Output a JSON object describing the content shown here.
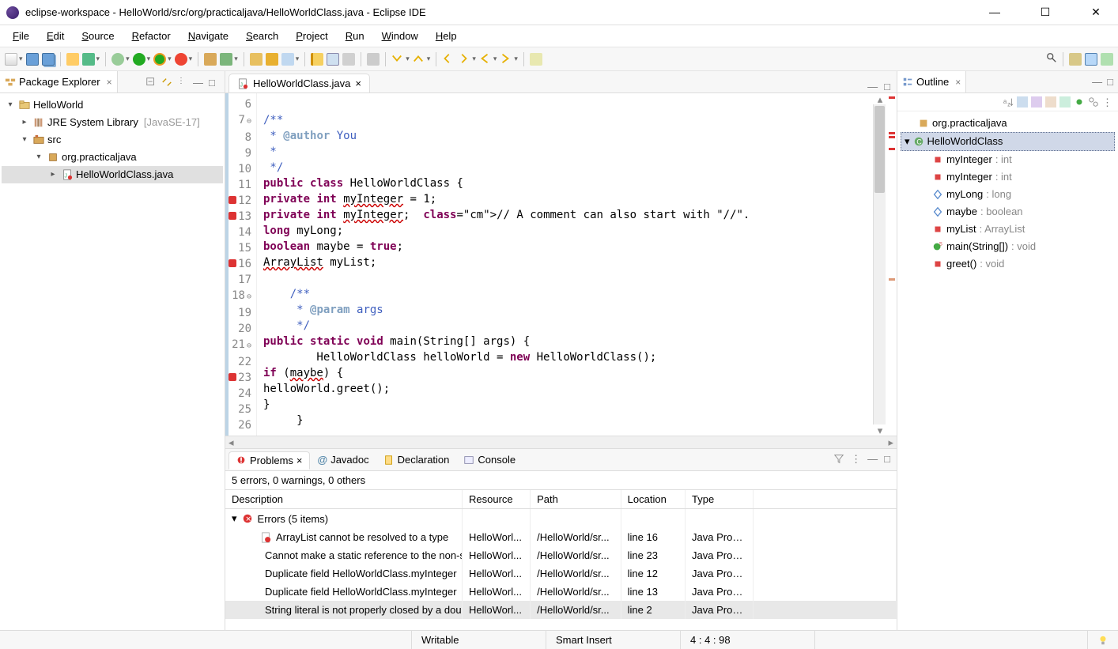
{
  "window": {
    "title": "eclipse-workspace - HelloWorld/src/org/practicaljava/HelloWorldClass.java - Eclipse IDE"
  },
  "menu": [
    "File",
    "Edit",
    "Source",
    "Refactor",
    "Navigate",
    "Search",
    "Project",
    "Run",
    "Window",
    "Help"
  ],
  "package_explorer": {
    "title": "Package Explorer",
    "project": "HelloWorld",
    "jre": "JRE System Library",
    "jre_ver": "[JavaSE-17]",
    "src": "src",
    "pkg": "org.practicaljava",
    "file": "HelloWorldClass.java"
  },
  "editor": {
    "tab": "HelloWorldClass.java",
    "lines": [
      {
        "n": "6",
        "t": ""
      },
      {
        "n": "7",
        "fold": "⊖",
        "t": "/**",
        "cls": "jd"
      },
      {
        "n": "8",
        "t": " * @author You",
        "cls": "jd",
        "tag": true
      },
      {
        "n": "9",
        "t": " *",
        "cls": "jd"
      },
      {
        "n": "10",
        "t": " */",
        "cls": "jd"
      },
      {
        "n": "11",
        "t": "public class HelloWorldClass {"
      },
      {
        "n": "12",
        "err": true,
        "t": "private int myInteger = 1;"
      },
      {
        "n": "13",
        "err": true,
        "t": "private int myInteger;  // A comment can also start with \"//\"."
      },
      {
        "n": "14",
        "t": "long myLong;"
      },
      {
        "n": "15",
        "t": "boolean maybe = true;"
      },
      {
        "n": "16",
        "err": true,
        "t": "ArrayList myList;"
      },
      {
        "n": "17",
        "t": ""
      },
      {
        "n": "18",
        "fold": "⊖",
        "t": "    /**",
        "cls": "jd"
      },
      {
        "n": "19",
        "t": "     * @param args",
        "cls": "jd",
        "tag": true
      },
      {
        "n": "20",
        "t": "     */",
        "cls": "jd"
      },
      {
        "n": "21",
        "fold": "⊖",
        "t": "public static void main(String[] args) {"
      },
      {
        "n": "22",
        "t": "        HelloWorldClass helloWorld = new HelloWorldClass();"
      },
      {
        "n": "23",
        "err": true,
        "t": "if (maybe) {"
      },
      {
        "n": "24",
        "t": "helloWorld.greet();"
      },
      {
        "n": "25",
        "t": "}"
      },
      {
        "n": "26",
        "t": "     }"
      }
    ]
  },
  "outline": {
    "title": "Outline",
    "pkg": "org.practicaljava",
    "class": "HelloWorldClass",
    "members": [
      {
        "name": "myInteger",
        "type": "int",
        "ico": "field-priv"
      },
      {
        "name": "myInteger",
        "type": "int",
        "ico": "field-priv"
      },
      {
        "name": "myLong",
        "type": "long",
        "ico": "field-def"
      },
      {
        "name": "maybe",
        "type": "boolean",
        "ico": "field-def"
      },
      {
        "name": "myList",
        "type": "ArrayList",
        "ico": "field-priv"
      },
      {
        "name": "main(String[])",
        "type": "void",
        "ico": "method-static"
      },
      {
        "name": "greet()",
        "type": "void",
        "ico": "method"
      }
    ]
  },
  "problems": {
    "tabs": [
      "Problems",
      "Javadoc",
      "Declaration",
      "Console"
    ],
    "summary": "5 errors, 0 warnings, 0 others",
    "cols": [
      "Description",
      "Resource",
      "Path",
      "Location",
      "Type"
    ],
    "group": "Errors (5 items)",
    "rows": [
      {
        "d": "ArrayList cannot be resolved to a type",
        "r": "HelloWorl...",
        "p": "/HelloWorld/sr...",
        "l": "line 16",
        "t": "Java Probl..."
      },
      {
        "d": "Cannot make a static reference to the non-static field maybe",
        "r": "HelloWorl...",
        "p": "/HelloWorld/sr...",
        "l": "line 23",
        "t": "Java Probl..."
      },
      {
        "d": "Duplicate field HelloWorldClass.myInteger",
        "r": "HelloWorl...",
        "p": "/HelloWorld/sr...",
        "l": "line 12",
        "t": "Java Probl..."
      },
      {
        "d": "Duplicate field HelloWorldClass.myInteger",
        "r": "HelloWorl...",
        "p": "/HelloWorld/sr...",
        "l": "line 13",
        "t": "Java Probl..."
      },
      {
        "d": "String literal is not properly closed by a double-quote",
        "r": "HelloWorl...",
        "p": "/HelloWorld/sr...",
        "l": "line 2",
        "t": "Java Probl...",
        "sel": true
      }
    ]
  },
  "status": {
    "writable": "Writable",
    "insert": "Smart Insert",
    "pos": "4 : 4 : 98"
  }
}
